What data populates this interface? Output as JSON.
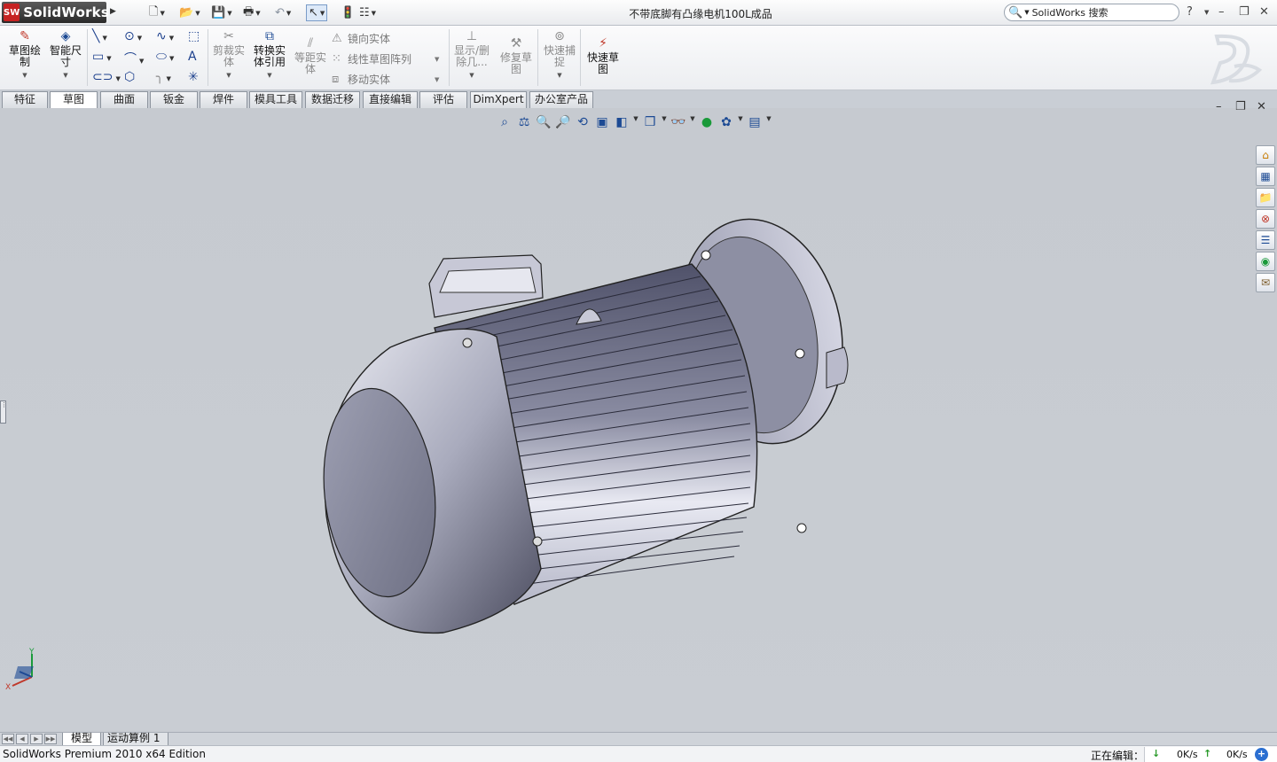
{
  "app": {
    "logo_text": "SolidWorks",
    "logo_badge": "SW"
  },
  "title": "不带底脚有凸缘电机100L成品",
  "search": {
    "placeholder": "SolidWorks 搜索"
  },
  "window_controls": {
    "help": "?",
    "minimize": "–",
    "restore": "❐",
    "close": "✕"
  },
  "quick_access": [
    "new-icon",
    "open-icon",
    "save-icon",
    "print-icon",
    "undo-icon",
    "select-icon",
    "rebuild-icon",
    "options-icon"
  ],
  "toolbar": {
    "sketch": "草图绘\n制",
    "smart_dim": "智能尺\n寸",
    "trim": "剪裁实\n体",
    "convert": "转换实\n体引用",
    "offset": "等距实\n体",
    "mirror": "镜向实体",
    "linear_pattern": "线性草图阵列",
    "move": "移动实体",
    "display_delete": "显示/删\n除几...",
    "repair": "修复草\n图",
    "quick_snap": "快速捕\n捉",
    "rapid_sketch": "快速草\n图"
  },
  "tabs": [
    {
      "label": "特征",
      "active": false
    },
    {
      "label": "草图",
      "active": true
    },
    {
      "label": "曲面",
      "active": false
    },
    {
      "label": "钣金",
      "active": false
    },
    {
      "label": "焊件",
      "active": false
    },
    {
      "label": "模具工具",
      "active": false
    },
    {
      "label": "数据迁移",
      "active": false
    },
    {
      "label": "直接编辑",
      "active": false
    },
    {
      "label": "评估",
      "active": false
    },
    {
      "label": "DimXpert",
      "active": false
    },
    {
      "label": "办公室产品",
      "active": false
    }
  ],
  "model_tabs": [
    {
      "label": "模型",
      "active": true
    },
    {
      "label": "运动算例 1",
      "active": false
    }
  ],
  "triad": {
    "x": "X",
    "y": "Y"
  },
  "status": {
    "left": "SolidWorks Premium 2010 x64 Edition",
    "editing": "正在编辑：",
    "down_speed": "0K/s",
    "up_speed": "0K/s"
  },
  "colors": {
    "accent": "#1c4a94",
    "viewport_bg": "#c8ccd2",
    "logo_red": "#c62222"
  }
}
